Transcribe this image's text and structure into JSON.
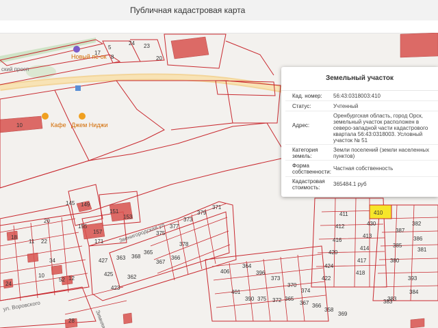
{
  "header": {
    "title": "Публичная кадастровая карта"
  },
  "map": {
    "pois": [
      "Новый пс-ок",
      "Кафе",
      "Джем Ниджи"
    ],
    "streets": [
      "ский просп",
      "Звенигородская ул",
      "Зимняя",
      "ул. Воровского"
    ],
    "parcels_left": [
      "17",
      "5",
      "8",
      "24",
      "23",
      "20",
      "10",
      "145",
      "149",
      "151",
      "153",
      "155",
      "157",
      "171",
      "20",
      "18",
      "22",
      "11",
      "34",
      "24",
      "10",
      "52",
      "12",
      "28"
    ],
    "parcels_mid": [
      "371",
      "379",
      "373",
      "377",
      "375",
      "378",
      "365",
      "368",
      "367",
      "366",
      "363",
      "362",
      "427",
      "425",
      "423",
      "406",
      "364",
      "401",
      "396",
      "373",
      "375",
      "372",
      "383",
      "390",
      "370",
      "374",
      "365",
      "367",
      "366",
      "358",
      "369"
    ],
    "parcels_right": [
      "411",
      "430",
      "412",
      "413",
      "416",
      "414",
      "417",
      "420",
      "418",
      "424",
      "422",
      "382",
      "387",
      "386",
      "385",
      "393",
      "384",
      "383",
      "380",
      "381",
      "410"
    ]
  },
  "popup": {
    "title": "Земельный участок",
    "fields": [
      {
        "key": "Кад. номер:",
        "value": "56:43:0318003:410"
      },
      {
        "key": "Статус:",
        "value": "Учтенный"
      },
      {
        "key": "Адрес:",
        "value": "Оренбургская область, город Орск, земельный участок расположен в северо-западной части кадастрового квартала 56:43:0318003. Условный участок № 51"
      },
      {
        "key": "Категория земель:",
        "value": "Земли поселений (земли населенных пунктов)"
      },
      {
        "key": "Форма собственности:",
        "value": "Частная собственность"
      },
      {
        "key": "Кадастровая стоимость:",
        "value": "365484.1 руб"
      }
    ]
  }
}
